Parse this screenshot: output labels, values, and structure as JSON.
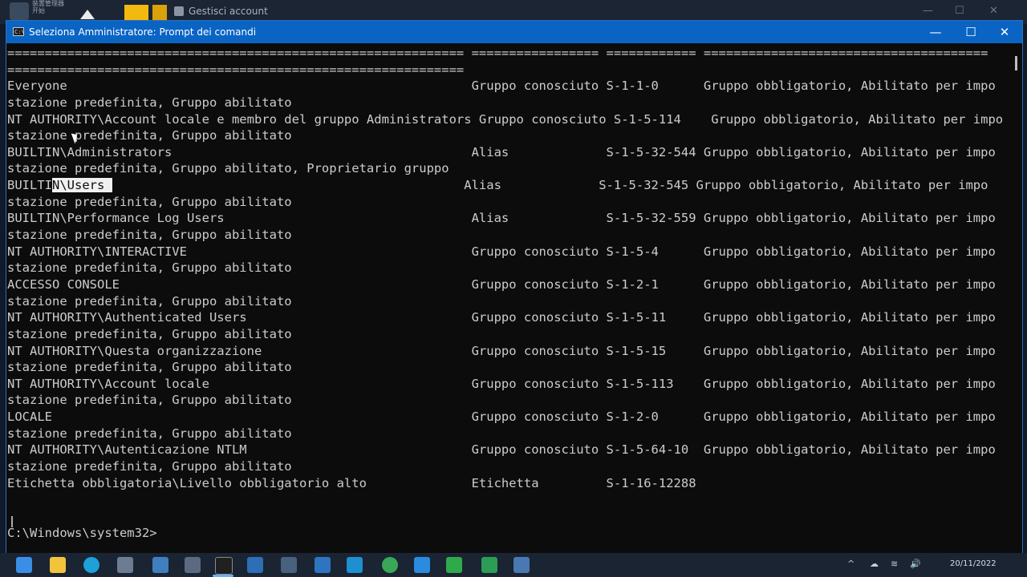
{
  "background_window": {
    "app_label": "装置管理器\n开始",
    "title": "Gestisci account",
    "controls": [
      "—",
      "☐",
      "✕"
    ]
  },
  "window": {
    "title": "Seleziona Amministratore: Prompt dei comandi",
    "cmd_icon_text": "C:\\",
    "minimize": "—",
    "maximize": "☐",
    "close": "✕"
  },
  "terminal": {
    "lines": [
      "============================================================= ================= ============ ======================================",
      "=============================================================",
      "Everyone                                                      Gruppo conosciuto S-1-1-0      Gruppo obbligatorio, Abilitato per impo",
      "stazione predefinita, Gruppo abilitato",
      "NT AUTHORITY\\Account locale e membro del gruppo Administrators Gruppo conosciuto S-1-5-114    Gruppo obbligatorio, Abilitato per impo",
      "stazione predefinita, Gruppo abilitato",
      "BUILTIN\\Administrators                                        Alias             S-1-5-32-544 Gruppo obbligatorio, Abilitato per impo",
      "stazione predefinita, Gruppo abilitato, Proprietario gruppo",
      "__SELECTED_LINE__",
      "stazione predefinita, Gruppo abilitato",
      "BUILTIN\\Performance Log Users                                 Alias             S-1-5-32-559 Gruppo obbligatorio, Abilitato per impo",
      "stazione predefinita, Gruppo abilitato",
      "NT AUTHORITY\\INTERACTIVE                                      Gruppo conosciuto S-1-5-4      Gruppo obbligatorio, Abilitato per impo",
      "stazione predefinita, Gruppo abilitato",
      "ACCESSO CONSOLE                                               Gruppo conosciuto S-1-2-1      Gruppo obbligatorio, Abilitato per impo",
      "stazione predefinita, Gruppo abilitato",
      "NT AUTHORITY\\Authenticated Users                              Gruppo conosciuto S-1-5-11     Gruppo obbligatorio, Abilitato per impo",
      "stazione predefinita, Gruppo abilitato",
      "NT AUTHORITY\\Questa organizzazione                            Gruppo conosciuto S-1-5-15     Gruppo obbligatorio, Abilitato per impo",
      "stazione predefinita, Gruppo abilitato",
      "NT AUTHORITY\\Account locale                                   Gruppo conosciuto S-1-5-113    Gruppo obbligatorio, Abilitato per impo",
      "stazione predefinita, Gruppo abilitato",
      "LOCALE                                                        Gruppo conosciuto S-1-2-0      Gruppo obbligatorio, Abilitato per impo",
      "stazione predefinita, Gruppo abilitato",
      "NT AUTHORITY\\Autenticazione NTLM                              Gruppo conosciuto S-1-5-64-10  Gruppo obbligatorio, Abilitato per impo",
      "stazione predefinita, Gruppo abilitato",
      "Etichetta obbligatoria\\Livello obbligatorio alto              Etichetta         S-1-16-12288",
      "",
      "",
      "C:\\Windows\\system32>"
    ],
    "selected_line": {
      "before": "BUILTI",
      "selected": "N\\Users ",
      "after": "                                               Alias             S-1-5-32-545 Gruppo obbligatorio, Abilitato per impo"
    }
  },
  "taskbar": {
    "tray_symbols": [
      "^",
      "☁",
      "≋",
      "🔊"
    ],
    "date": "20/11/2022"
  },
  "colors": {
    "titlebar": "#0a64c4",
    "terminal_bg": "#0c0c0c",
    "terminal_fg": "#cccccc"
  }
}
